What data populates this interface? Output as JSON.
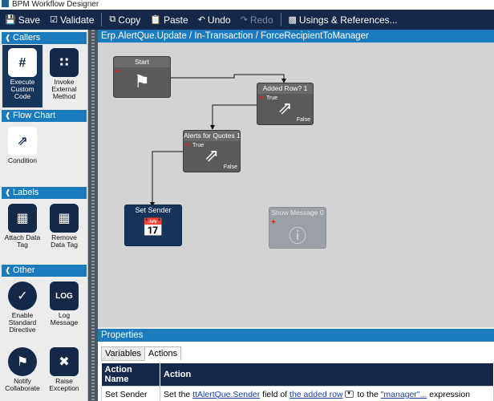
{
  "window": {
    "title": "BPM Workflow Designer"
  },
  "toolbar": {
    "save": "Save",
    "validate": "Validate",
    "copy": "Copy",
    "paste": "Paste",
    "undo": "Undo",
    "redo": "Redo",
    "usings": "Usings & References..."
  },
  "sidebar": {
    "callers": {
      "title": "Callers",
      "items": [
        {
          "label": "Execute Custom Code",
          "icon": "hash-document-icon"
        },
        {
          "label": "Invoke External Method",
          "icon": "network-icon"
        }
      ]
    },
    "flowchart": {
      "title": "Flow Chart",
      "items": [
        {
          "label": "Condition",
          "icon": "diamond-arrow-icon"
        }
      ]
    },
    "labels": {
      "title": "Labels",
      "items": [
        {
          "label": "Attach Data Tag",
          "icon": "table-tag-icon"
        },
        {
          "label": "Remove Data Tag",
          "icon": "table-remove-icon"
        }
      ]
    },
    "other": {
      "title": "Other",
      "items": [
        {
          "label": "Enable Standard Directive",
          "icon": "enable-directive-icon"
        },
        {
          "label": "Log Message",
          "icon": "log-icon"
        },
        {
          "label": "Notify Collaborate",
          "icon": "bell-icon"
        },
        {
          "label": "Raise Exception",
          "icon": "exception-icon"
        }
      ]
    }
  },
  "canvas": {
    "title": "Erp.AlertQue.Update / In-Transaction / ForceRecipientToManager",
    "nodes": {
      "start": {
        "title": "Start"
      },
      "added_row": {
        "title": "Added Row? 1",
        "true": "True",
        "false": "False"
      },
      "alerts": {
        "title": "Alerts for Quotes 1",
        "true": "True",
        "false": "False"
      },
      "set_sender": {
        "title": "Set Sender"
      },
      "show_message": {
        "title": "Show Message 0"
      }
    }
  },
  "properties": {
    "title": "Properties",
    "tabs": [
      "Variables",
      "Actions"
    ],
    "active_tab": "Actions",
    "columns": [
      "Action Name",
      "Action"
    ],
    "rows": [
      {
        "name": "Set Sender",
        "p1": "Set the ",
        "field": "ttAlertQue.Sender",
        "p2": " field of ",
        "row": "the added row",
        "p3": " to the ",
        "expr": "\"manager\"...",
        "p4": " expression"
      }
    ]
  },
  "colors": {
    "toolbar": "#14294a",
    "header": "#1c7bbd",
    "canvas": "#d3d3d3",
    "node": "#5a5a5a",
    "node_selected": "#15355a",
    "add_marker": "#e01e1e"
  }
}
